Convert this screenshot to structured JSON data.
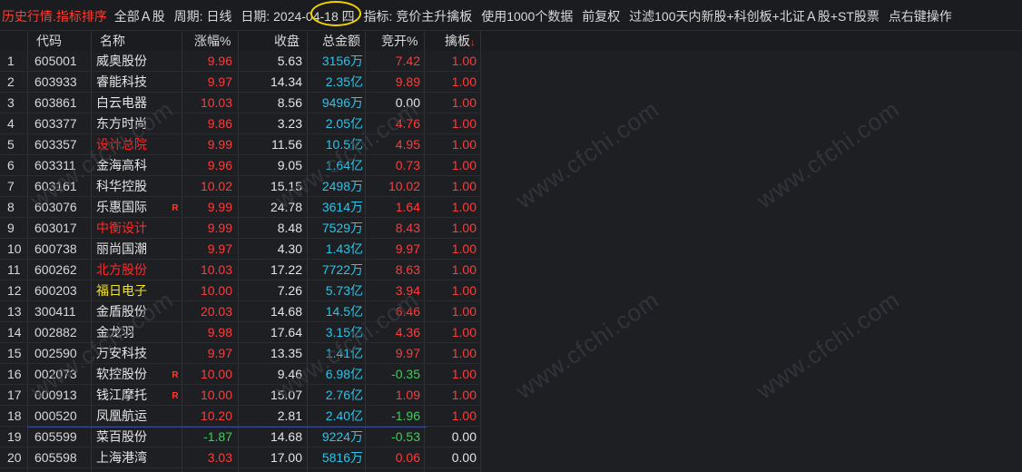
{
  "topbar": {
    "title": "历史行情.指标排序",
    "market": "全部Ａ股",
    "period": "周期: 日线",
    "date": "日期: 2024-04-18 四",
    "indicator": "指标: 竞价主升擒板",
    "usage": "使用1000个数据",
    "fq": "前复权",
    "filter": "过滤100天内新股+科创板+北证Ａ股+ST股票",
    "hint": "点右键操作"
  },
  "columns": {
    "code": "代码",
    "name": "名称",
    "change": "涨幅%",
    "close": "收盘",
    "amount": "总金额",
    "open": "竞开%",
    "qb": "擒板",
    "sort_arrow": "↓"
  },
  "colors": {
    "up": "#ff3b3b",
    "down": "#3ccf5a",
    "amount": "#2ec3e6",
    "highlight": "#f3d400"
  },
  "watermark": "www.cfchi.com",
  "rows": [
    {
      "idx": "1",
      "code": "605001",
      "name": "威奥股份",
      "flag": "",
      "chg": "9.96",
      "close": "5.63",
      "amount": "3156万",
      "open": "7.42",
      "qb": "1.00"
    },
    {
      "idx": "2",
      "code": "603933",
      "name": "睿能科技",
      "flag": "",
      "chg": "9.97",
      "close": "14.34",
      "amount": "2.35亿",
      "open": "9.89",
      "qb": "1.00"
    },
    {
      "idx": "3",
      "code": "603861",
      "name": "白云电器",
      "flag": "",
      "chg": "10.03",
      "close": "8.56",
      "amount": "9496万",
      "open": "0.00",
      "qb": "1.00"
    },
    {
      "idx": "4",
      "code": "603377",
      "name": "东方时尚",
      "flag": "",
      "chg": "9.86",
      "close": "3.23",
      "amount": "2.05亿",
      "open": "4.76",
      "qb": "1.00"
    },
    {
      "idx": "5",
      "code": "603357",
      "name": "设计总院",
      "flag": "",
      "chg": "9.99",
      "close": "11.56",
      "amount": "10.5亿",
      "open": "4.95",
      "qb": "1.00"
    },
    {
      "idx": "6",
      "code": "603311",
      "name": "金海高科",
      "flag": "",
      "chg": "9.96",
      "close": "9.05",
      "amount": "1.64亿",
      "open": "0.73",
      "qb": "1.00"
    },
    {
      "idx": "7",
      "code": "603161",
      "name": "科华控股",
      "flag": "",
      "chg": "10.02",
      "close": "15.15",
      "amount": "2498万",
      "open": "10.02",
      "qb": "1.00"
    },
    {
      "idx": "8",
      "code": "603076",
      "name": "乐惠国际",
      "flag": "R",
      "chg": "9.99",
      "close": "24.78",
      "amount": "3614万",
      "open": "1.64",
      "qb": "1.00"
    },
    {
      "idx": "9",
      "code": "603017",
      "name": "中衡设计",
      "flag": "",
      "chg": "9.99",
      "close": "8.48",
      "amount": "7529万",
      "open": "8.43",
      "qb": "1.00"
    },
    {
      "idx": "10",
      "code": "600738",
      "name": "丽尚国潮",
      "flag": "",
      "chg": "9.97",
      "close": "4.30",
      "amount": "1.43亿",
      "open": "9.97",
      "qb": "1.00"
    },
    {
      "idx": "11",
      "code": "600262",
      "name": "北方股份",
      "flag": "",
      "chg": "10.03",
      "close": "17.22",
      "amount": "7722万",
      "open": "8.63",
      "qb": "1.00"
    },
    {
      "idx": "12",
      "code": "600203",
      "name": "福日电子",
      "flag": "",
      "chg": "10.00",
      "close": "7.26",
      "amount": "5.73亿",
      "open": "3.94",
      "qb": "1.00"
    },
    {
      "idx": "13",
      "code": "300411",
      "name": "金盾股份",
      "flag": "",
      "chg": "20.03",
      "close": "14.68",
      "amount": "14.5亿",
      "open": "6.46",
      "qb": "1.00"
    },
    {
      "idx": "14",
      "code": "002882",
      "name": "金龙羽",
      "flag": "",
      "chg": "9.98",
      "close": "17.64",
      "amount": "3.15亿",
      "open": "4.36",
      "qb": "1.00"
    },
    {
      "idx": "15",
      "code": "002590",
      "name": "万安科技",
      "flag": "",
      "chg": "9.97",
      "close": "13.35",
      "amount": "1.41亿",
      "open": "9.97",
      "qb": "1.00"
    },
    {
      "idx": "16",
      "code": "002073",
      "name": "软控股份",
      "flag": "R",
      "chg": "10.00",
      "close": "9.46",
      "amount": "6.98亿",
      "open": "-0.35",
      "qb": "1.00"
    },
    {
      "idx": "17",
      "code": "000913",
      "name": "钱江摩托",
      "flag": "R",
      "chg": "10.00",
      "close": "15.07",
      "amount": "2.76亿",
      "open": "1.09",
      "qb": "1.00"
    },
    {
      "idx": "18",
      "code": "000520",
      "name": "凤凰航运",
      "flag": "",
      "chg": "10.20",
      "close": "2.81",
      "amount": "2.40亿",
      "open": "-1.96",
      "qb": "1.00"
    },
    {
      "idx": "19",
      "code": "605599",
      "name": "菜百股份",
      "flag": "",
      "chg": "-1.87",
      "close": "14.68",
      "amount": "9224万",
      "open": "-0.53",
      "qb": "0.00"
    },
    {
      "idx": "20",
      "code": "605598",
      "name": "上海港湾",
      "flag": "",
      "chg": "3.03",
      "close": "17.00",
      "amount": "5816万",
      "open": "0.06",
      "qb": "0.00"
    }
  ]
}
